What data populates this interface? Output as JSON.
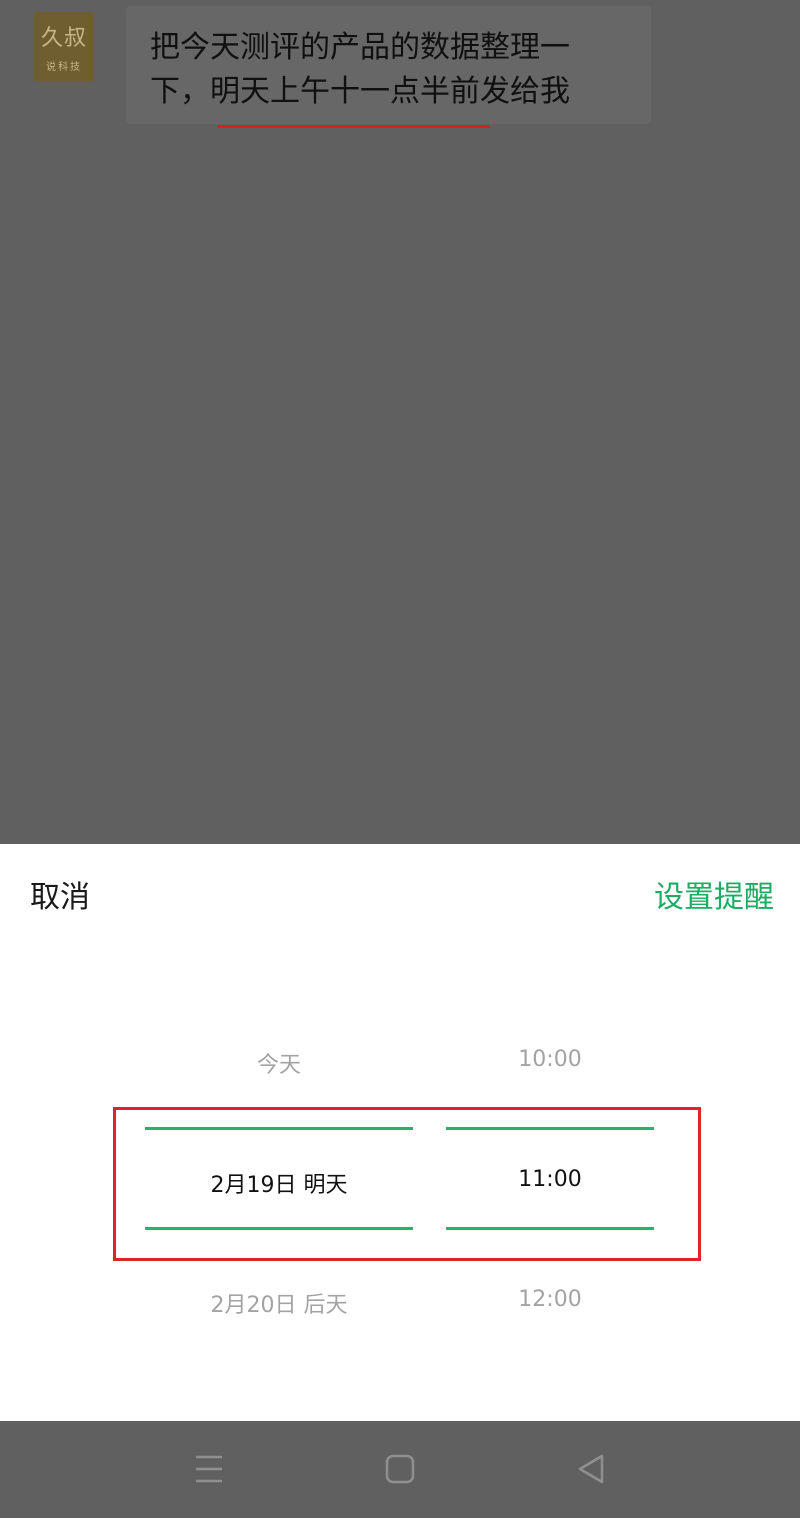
{
  "chat": {
    "avatar": {
      "title": "久叔",
      "subtitle": "说科技"
    },
    "message": "把今天测评的产品的数据整理一下，明天上午十一点半前发给我"
  },
  "sheet": {
    "cancel_label": "取消",
    "confirm_label": "设置提醒",
    "date_column": {
      "previous": "今天",
      "selected": "2月19日 明天",
      "next": "2月20日 后天"
    },
    "time_column": {
      "previous": "10:00",
      "selected": "11:00",
      "next": "12:00"
    }
  },
  "navbar": {
    "icons": [
      "menu-icon",
      "home-icon",
      "back-icon"
    ]
  },
  "colors": {
    "accent": "#1aad63",
    "highlight": "#e0232a",
    "overlay": "#616061"
  }
}
